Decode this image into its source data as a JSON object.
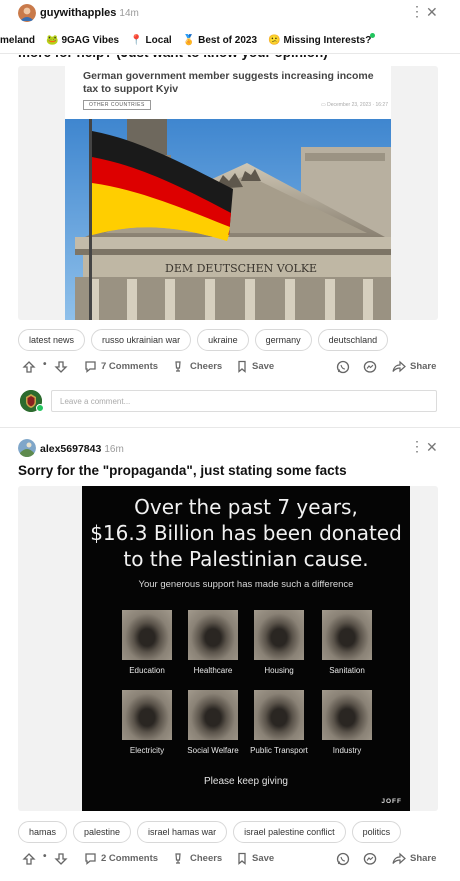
{
  "post1": {
    "username": "guywithapples",
    "time": "14m",
    "menu_icon": "more-vertical-icon",
    "close_icon": "close-icon",
    "title_cut": "more for help? (Just want to know your opinion)",
    "article": {
      "headline": "German government member suggests increasing income tax to support Kyiv",
      "category": "OTHER COUNTRIES",
      "date": "December 23, 2023 · 16:27",
      "photo_inscription": "DEM DEUTSCHEN VOLKE"
    },
    "tags": [
      "latest news",
      "russo ukrainian war",
      "ukraine",
      "germany",
      "deutschland"
    ],
    "actions": {
      "comments": "7 Comments",
      "cheers": "Cheers",
      "save": "Save",
      "share": "Share"
    }
  },
  "ribbon": [
    {
      "icon": "",
      "label": "meland"
    },
    {
      "icon": "🐸",
      "label": "9GAG Vibes"
    },
    {
      "icon": "📍",
      "label": "Local"
    },
    {
      "icon": "🏅",
      "label": "Best of 2023"
    },
    {
      "icon": "😕",
      "label": "Missing Interests?"
    }
  ],
  "comment_box": {
    "placeholder": "Leave a comment..."
  },
  "post2": {
    "username": "alex5697843",
    "time": "16m",
    "title": "Sorry for the \"propaganda\", just stating some facts",
    "image": {
      "headline_lines": [
        "Over the past 7 years,",
        "$16.3 Billion has been donated",
        "to the Palestinian cause."
      ],
      "subline": "Your generous support has made such a difference",
      "labels": [
        "Education",
        "Healthcare",
        "Housing",
        "Sanitation",
        "Electricity",
        "Social Welfare",
        "Public Transport",
        "Industry"
      ],
      "footer": "Please keep giving",
      "signature": "JOFF"
    },
    "tags": [
      "hamas",
      "palestine",
      "israel hamas war",
      "israel palestine conflict",
      "politics"
    ],
    "actions": {
      "comments": "2 Comments",
      "cheers": "Cheers",
      "save": "Save",
      "share": "Share"
    }
  },
  "colors": {
    "accent_green": "#22c55e",
    "flag_black": "#1a1a1a",
    "flag_red": "#dd0000",
    "flag_gold": "#ffce00"
  }
}
